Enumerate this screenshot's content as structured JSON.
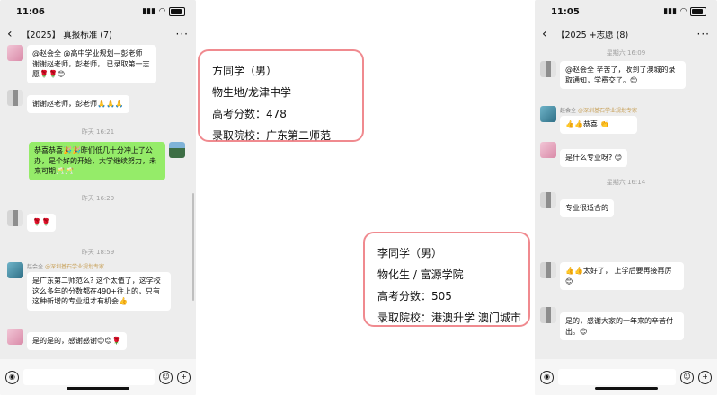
{
  "left_phone": {
    "status_time": "11:06",
    "title": "【2025】         真报标准",
    "member_count": "(7)",
    "messages": [
      {
        "text": "@赵会全 @高中学业规划—彭老师 谢谢赵老师，彭老师，      已录取第一志愿🌹🌹😊"
      },
      {
        "text": "谢谢赵老师，彭老师🙏🙏🙏"
      }
    ],
    "time1": "昨天 16:21",
    "green_message": "恭喜恭喜🎉🎉昨们低几十分冲上了公办，是个好的开始，大学继续努力，未来可期🥂🥂",
    "time2": "昨天 16:29",
    "flowers": "🌹🌹",
    "time3": "昨天 18:59",
    "sender_name": "赵会全",
    "sender_tag": "@深圳基石学业规划专家",
    "reply": "是广东第二师范么? 这个太值了，这学校这么多年的分数都在490+往上的，只有这种新增的专业组才有机会👍",
    "last": "是的是的，感谢感谢😊😊🌹"
  },
  "card1": {
    "name": "方同学（男）",
    "subjects": "物生地/龙津中学",
    "score": "高考分数：478",
    "admitted": "录取院校：广东第二师范"
  },
  "card2": {
    "name": "李同学（男）",
    "subjects": "物化生 / 富源学院",
    "score": "高考分数：505",
    "admitted": "录取院校：港澳升学 澳门城市"
  },
  "right_phone": {
    "status_time": "11:05",
    "title": "【2025          +志愿",
    "member_count": "(8)",
    "time1": "星期六 16:09",
    "msg1": "@赵会全 辛苦了，收到了澳城的录取通知，学费交了。😊",
    "sender_name": "赵会全",
    "sender_tag": "@深圳基石学业规划专家",
    "msg2": "👍👍恭喜      👏",
    "msg3": "是什么专业呀? 😊",
    "time2": "星期六 16:14",
    "msg4": "专业很适合的",
    "msg5": "👍👍太好了，  上学后要再接再厉😊",
    "msg6": "是的，感谢大家的一年来的辛苦付出。😊"
  }
}
